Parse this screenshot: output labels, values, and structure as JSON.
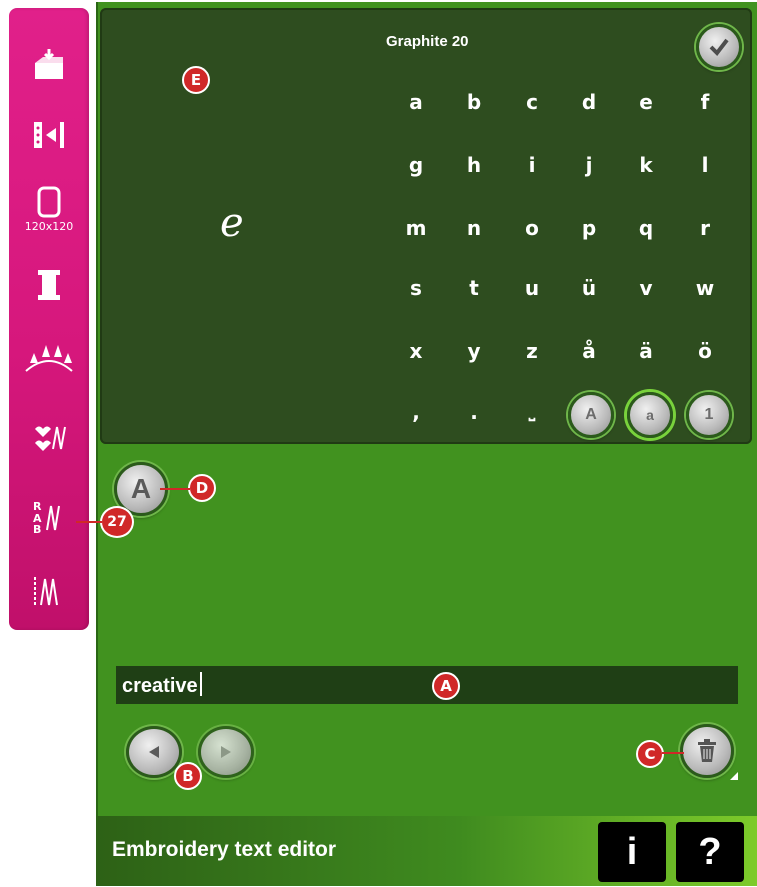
{
  "sidebar": {
    "items": [
      {
        "icon": "load-design-icon"
      },
      {
        "icon": "jump-stitch-icon"
      },
      {
        "icon": "hoop-icon",
        "label": "120x120"
      },
      {
        "icon": "thread-spool-icon"
      },
      {
        "icon": "embroidery-motif-icon"
      },
      {
        "icon": "stitch-heart-icon"
      },
      {
        "icon": "stitch-letters-icon",
        "callout": "27"
      },
      {
        "icon": "stitch-zigzag-icon"
      }
    ]
  },
  "keyboard": {
    "font_name": "Graphite 20",
    "rows": [
      [
        "a",
        "b",
        "c",
        "d",
        "e",
        "f"
      ],
      [
        "g",
        "h",
        "i",
        "j",
        "k",
        "l"
      ],
      [
        "m",
        "n",
        "o",
        "p",
        "q",
        "r"
      ],
      [
        "s",
        "t",
        "u",
        "ü",
        "v",
        "w"
      ],
      [
        "x",
        "y",
        "z",
        "å",
        "ä",
        "ö"
      ]
    ],
    "bottom_keys": [
      ",",
      ".",
      "⎵"
    ],
    "mode_buttons": [
      "A",
      "a",
      "1"
    ],
    "confirm_icon": "check-icon",
    "preview_glyph": "e"
  },
  "font_button_label": "A",
  "text_field": {
    "value": "creative"
  },
  "callouts": {
    "E": "E",
    "D": "D",
    "A": "A",
    "B": "B",
    "C": "C"
  },
  "bottom_bar": {
    "title": "Embroidery text editor",
    "info_label": "i",
    "help_label": "?"
  },
  "colors": {
    "sidebar": "#e1208a",
    "screen": "#41921f",
    "panel": "#2e4d1f",
    "callout": "#d02828"
  }
}
